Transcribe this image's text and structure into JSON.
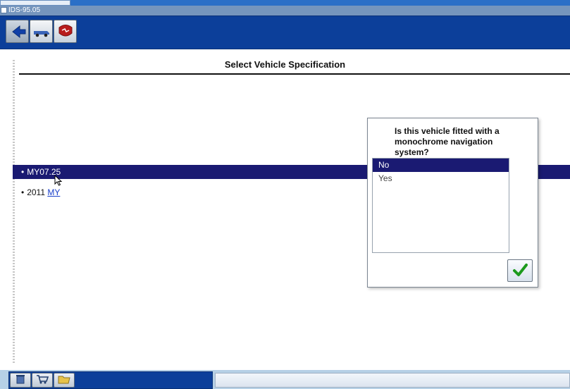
{
  "window": {
    "taskbar_tab_label": "",
    "child_title": "IDS-95.05"
  },
  "toolbar": {
    "buttons": [
      {
        "name": "back-button",
        "icon": "arrow-left-icon"
      },
      {
        "name": "vehicle-button",
        "icon": "truck-icon"
      },
      {
        "name": "diagnostics-button",
        "icon": "red-badge-icon"
      }
    ]
  },
  "page": {
    "title": "Select Vehicle Specification"
  },
  "spec_list": [
    {
      "label": "MY07.25",
      "selected": true,
      "link_suffix": ""
    },
    {
      "label": "2011 ",
      "selected": false,
      "link_suffix": "MY"
    }
  ],
  "question_panel": {
    "prompt": "Is this vehicle fitted with a monochrome navigation system?",
    "options": [
      {
        "label": "No",
        "selected": true
      },
      {
        "label": "Yes",
        "selected": false
      }
    ],
    "confirm_label": "OK"
  },
  "bottom_tray": {
    "buttons": [
      {
        "name": "waste-bin-button",
        "icon": "trash-icon"
      },
      {
        "name": "cart-button",
        "icon": "cart-icon"
      },
      {
        "name": "open-folder-button",
        "icon": "folder-open-icon"
      }
    ]
  },
  "colors": {
    "brand_blue": "#0c3f9a",
    "selection_navy": "#1a1a72",
    "desktop_blue": "#b6d0e6"
  }
}
